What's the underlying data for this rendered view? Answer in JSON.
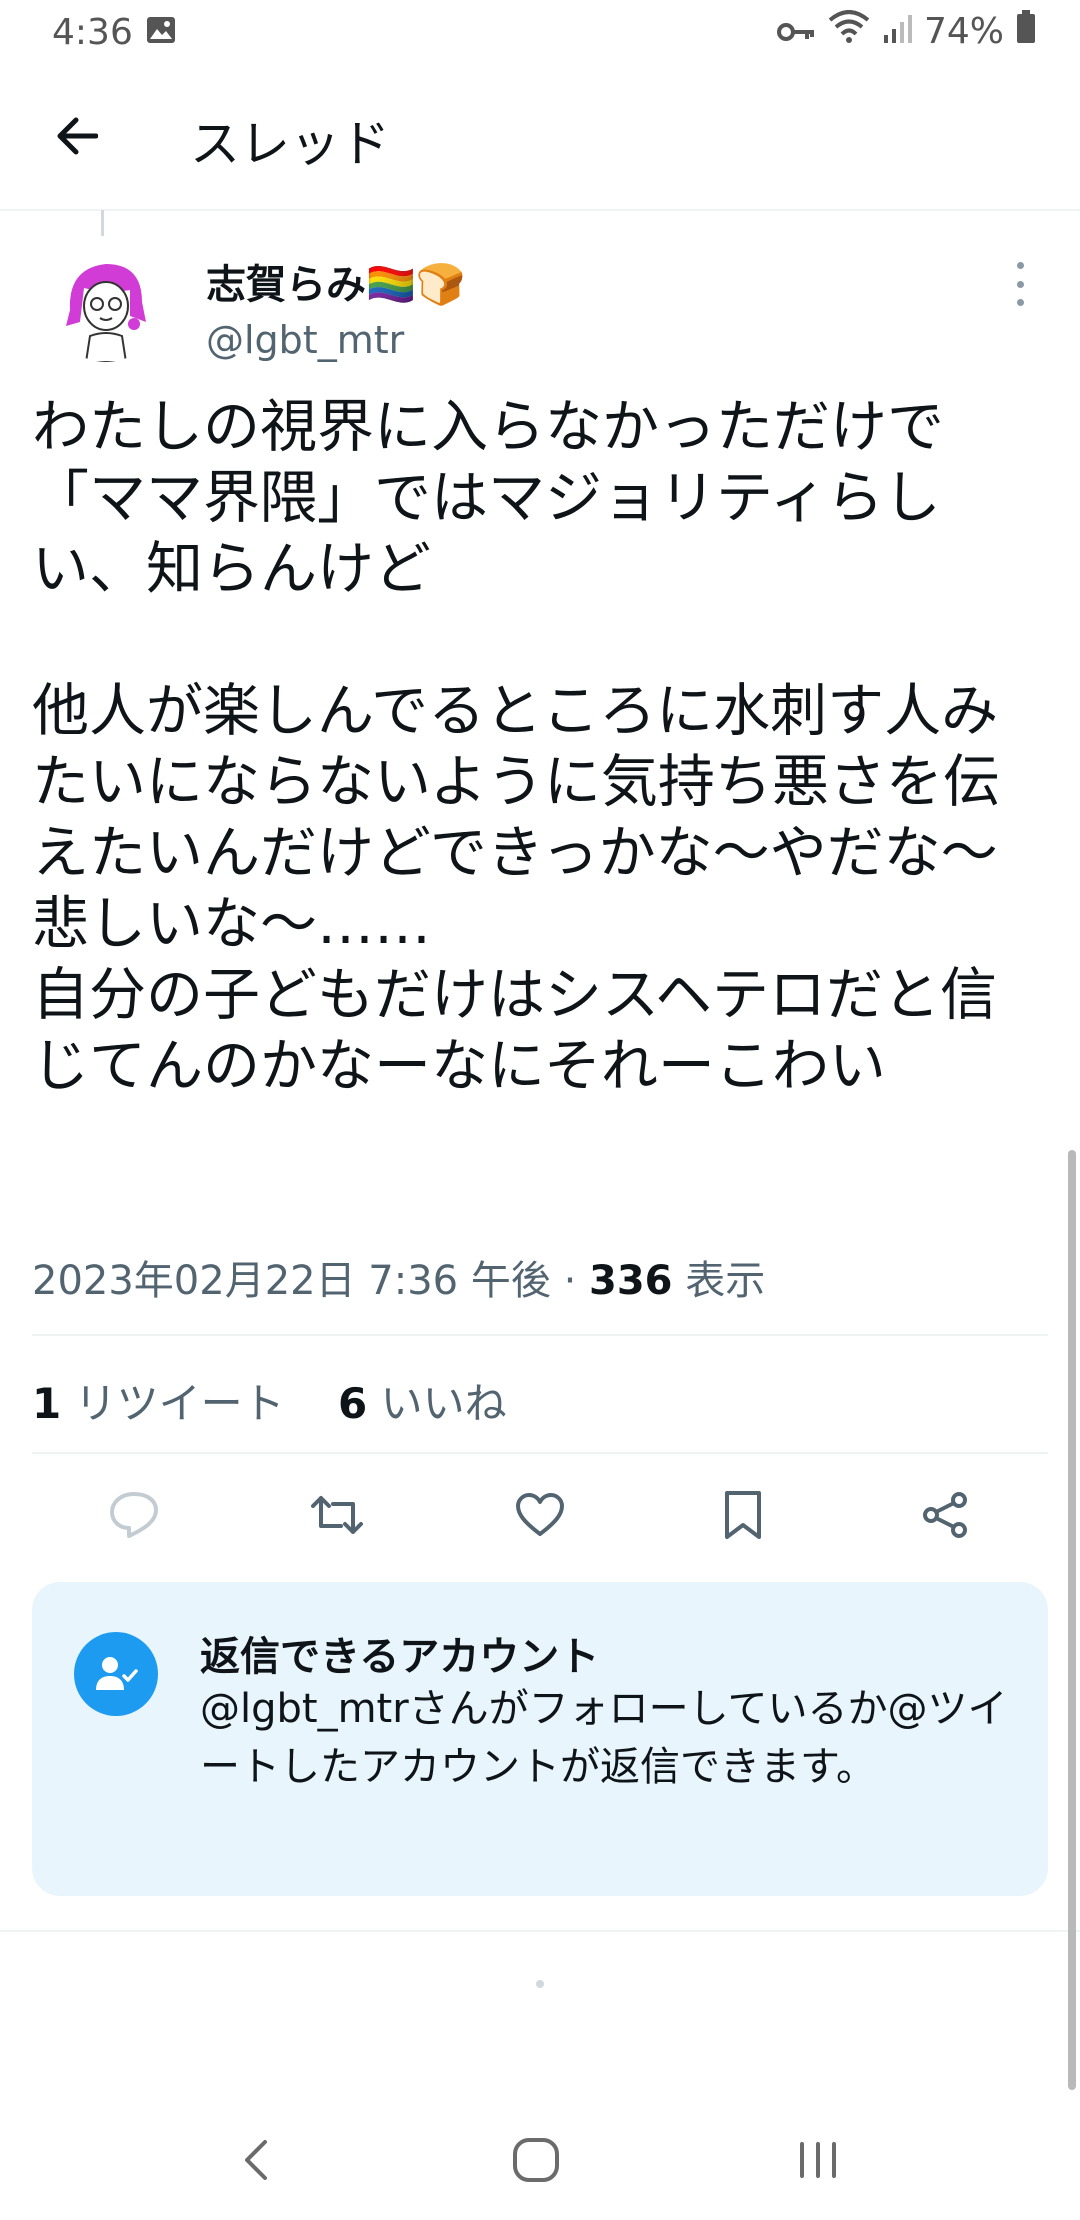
{
  "status_bar": {
    "time": "4:36",
    "battery": "74%"
  },
  "header": {
    "title": "スレッド"
  },
  "tweet": {
    "display_name": "志賀らみ",
    "name_emojis": "🏳️‍🌈🍞",
    "handle": "@lgbt_mtr",
    "text": "わたしの視界に入らなかっただけで「ママ界隈」ではマジョリティらしい、知らんけど\n\n他人が楽しんでるところに水刺す人みたいにならないように気持ち悪さを伝えたいんだけどできっかな〜やだな〜悲しいな〜……\n自分の子どもだけはシスヘテロだと信じてんのかなーなにそれーこわい",
    "timestamp": "2023年02月22日 7:36 午後",
    "separator": " · ",
    "views_count": "336",
    "views_label": "表示",
    "retweet_count": "1",
    "retweet_label": "リツイート",
    "like_count": "6",
    "like_label": "いいね"
  },
  "reply_notice": {
    "title": "返信できるアカウント",
    "body": "@lgbt_mtrさんがフォローしているか@ツイートしたアカウントが返信できます。"
  },
  "colors": {
    "accent": "#1d9bf0",
    "card_bg": "#e8f5fd",
    "secondary_text": "#536471"
  }
}
